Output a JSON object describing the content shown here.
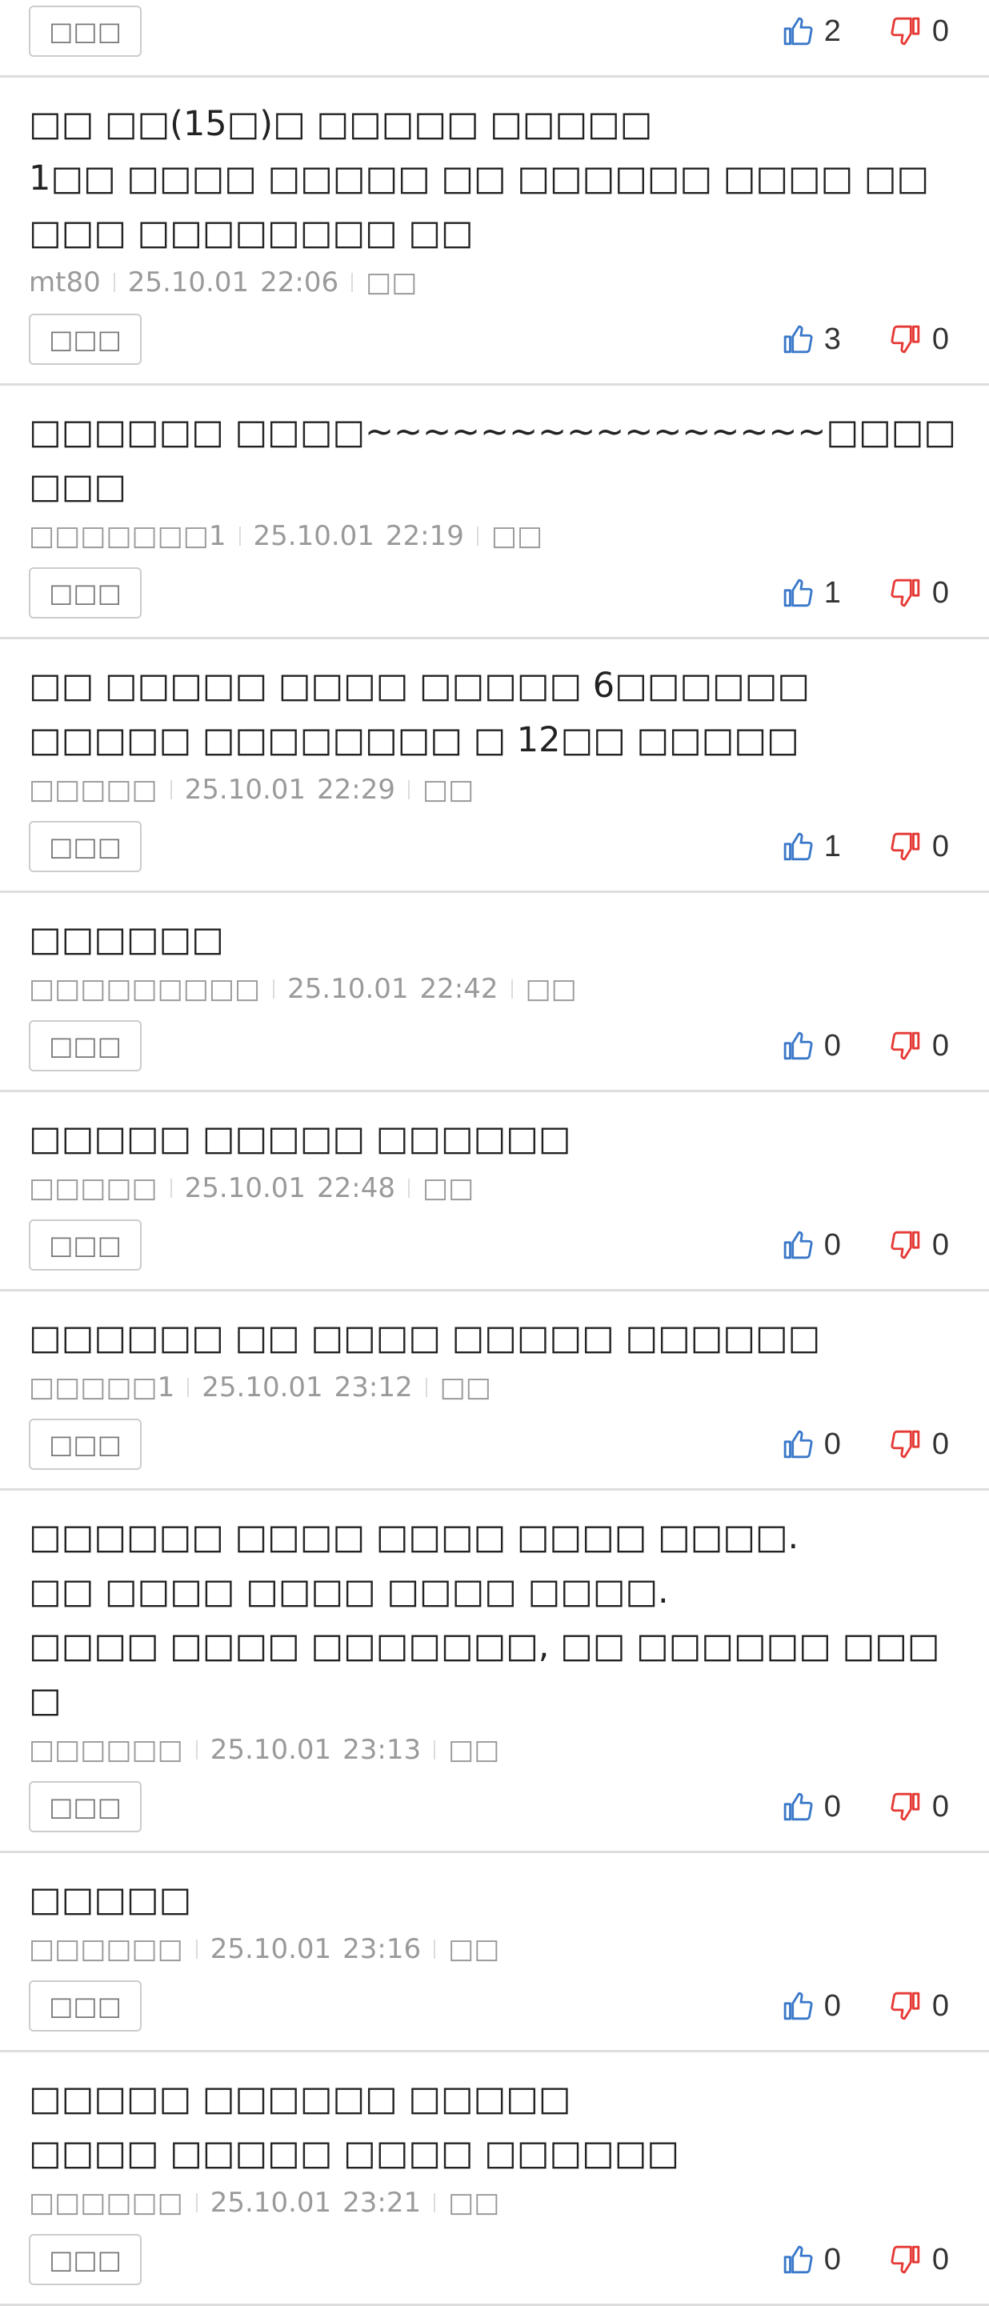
{
  "colors": {
    "like": "#3a78c9",
    "dislike": "#e53935",
    "divider": "#dddddd",
    "meta_text": "#9a9a9a"
  },
  "icons": {
    "like": "thumbs-up-icon",
    "dislike": "thumbs-down-icon"
  },
  "comments": [
    {
      "text": "",
      "author": "",
      "date": "",
      "time": "",
      "report": "",
      "reply_label": "□□□",
      "likes": "2",
      "dislikes": "0"
    },
    {
      "text": "□□ □□(15□)□ □□□□□ □□□□□\n1□□ □□□□ □□□□□ □□ □□□□□□ □□□□ □□□□□ □□□□□□□□ □□",
      "author": "mt80",
      "date": "25.10.01",
      "time": "22:06",
      "report": "□□",
      "reply_label": "□□□",
      "likes": "3",
      "dislikes": "0"
    },
    {
      "text": "□□□□□□ □□□□~~~~~~~~~~~~~~~~□□□□□□□",
      "author": "□□□□□□□1",
      "date": "25.10.01",
      "time": "22:19",
      "report": "□□",
      "reply_label": "□□□",
      "likes": "1",
      "dislikes": "0"
    },
    {
      "text": "□□ □□□□□ □□□□ □□□□□ 6□□□□□□\n□□□□□ □□□□□□□□ □ 12□□ □□□□□",
      "author": "□□□□□",
      "date": "25.10.01",
      "time": "22:29",
      "report": "□□",
      "reply_label": "□□□",
      "likes": "1",
      "dislikes": "0"
    },
    {
      "text": "□□□□□□",
      "author": "□□□□□□□□□",
      "date": "25.10.01",
      "time": "22:42",
      "report": "□□",
      "reply_label": "□□□",
      "likes": "0",
      "dislikes": "0"
    },
    {
      "text": "□□□□□ □□□□□ □□□□□□",
      "author": "□□□□□",
      "date": "25.10.01",
      "time": "22:48",
      "report": "□□",
      "reply_label": "□□□",
      "likes": "0",
      "dislikes": "0"
    },
    {
      "text": "□□□□□□ □□ □□□□ □□□□□ □□□□□□",
      "author": "□□□□□1",
      "date": "25.10.01",
      "time": "23:12",
      "report": "□□",
      "reply_label": "□□□",
      "likes": "0",
      "dislikes": "0"
    },
    {
      "text": "□□□□□□ □□□□ □□□□ □□□□ □□□□.\n□□ □□□□ □□□□ □□□□ □□□□.\n□□□□ □□□□ □□□□□□□, □□ □□□□□□ □□□□",
      "author": "□□□□□□",
      "date": "25.10.01",
      "time": "23:13",
      "report": "□□",
      "reply_label": "□□□",
      "likes": "0",
      "dislikes": "0"
    },
    {
      "text": "□□□□□",
      "author": "□□□□□□",
      "date": "25.10.01",
      "time": "23:16",
      "report": "□□",
      "reply_label": "□□□",
      "likes": "0",
      "dislikes": "0"
    },
    {
      "text": "□□□□□ □□□□□□ □□□□□\n□□□□ □□□□□ □□□□ □□□□□□",
      "author": "□□□□□□",
      "date": "25.10.01",
      "time": "23:21",
      "report": "□□",
      "reply_label": "□□□",
      "likes": "0",
      "dislikes": "0"
    }
  ]
}
